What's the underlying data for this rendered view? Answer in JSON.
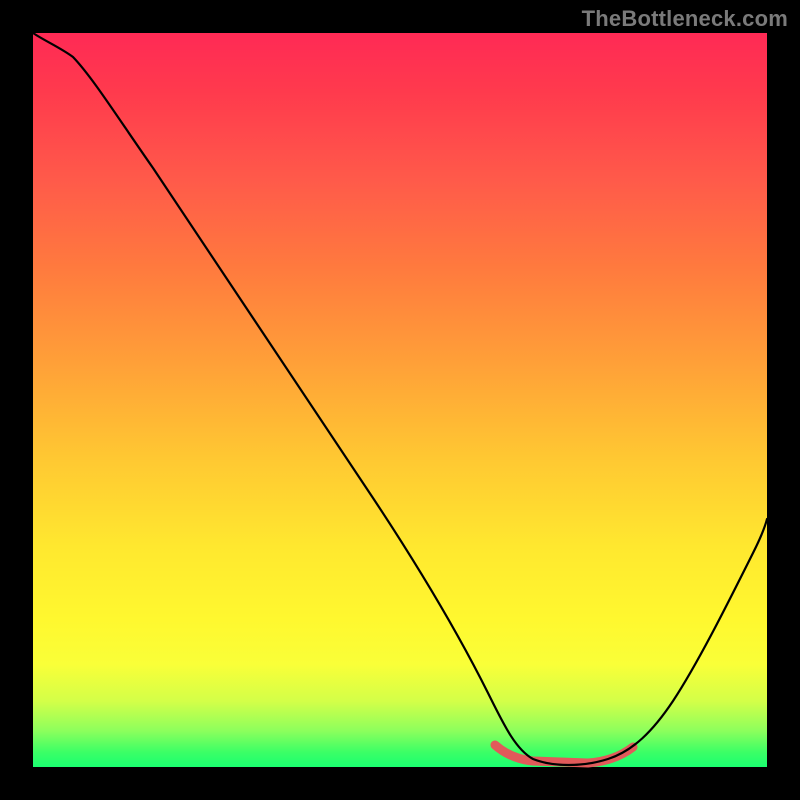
{
  "watermark": "TheBottleneck.com",
  "colors": {
    "background": "#000000",
    "gradient_top": "#ff2a55",
    "gradient_bottom": "#1aff70",
    "curve": "#000000",
    "highlight": "#e15a5a"
  },
  "chart_data": {
    "type": "line",
    "title": "",
    "xlabel": "",
    "ylabel": "",
    "xlim": [
      0,
      100
    ],
    "ylim": [
      0,
      100
    ],
    "grid": false,
    "legend": false,
    "x": [
      0,
      2,
      5,
      10,
      20,
      30,
      40,
      50,
      55,
      60,
      63,
      66,
      70,
      75,
      80,
      85,
      90,
      95,
      100
    ],
    "values": [
      100,
      99,
      97.5,
      92,
      79,
      66,
      52,
      37,
      29,
      18,
      9,
      3,
      0.5,
      0,
      0.5,
      3,
      9,
      20,
      35
    ],
    "series": [
      {
        "name": "bottleneck-curve",
        "x": [
          0,
          2,
          5,
          10,
          20,
          30,
          40,
          50,
          55,
          60,
          63,
          66,
          70,
          75,
          80,
          85,
          90,
          95,
          100
        ],
        "y": [
          100,
          99,
          97.5,
          92,
          79,
          66,
          52,
          37,
          29,
          18,
          9,
          3,
          0.5,
          0,
          0.5,
          3,
          9,
          20,
          35
        ]
      }
    ],
    "highlight_range_x": [
      63,
      82
    ],
    "annotations": []
  }
}
